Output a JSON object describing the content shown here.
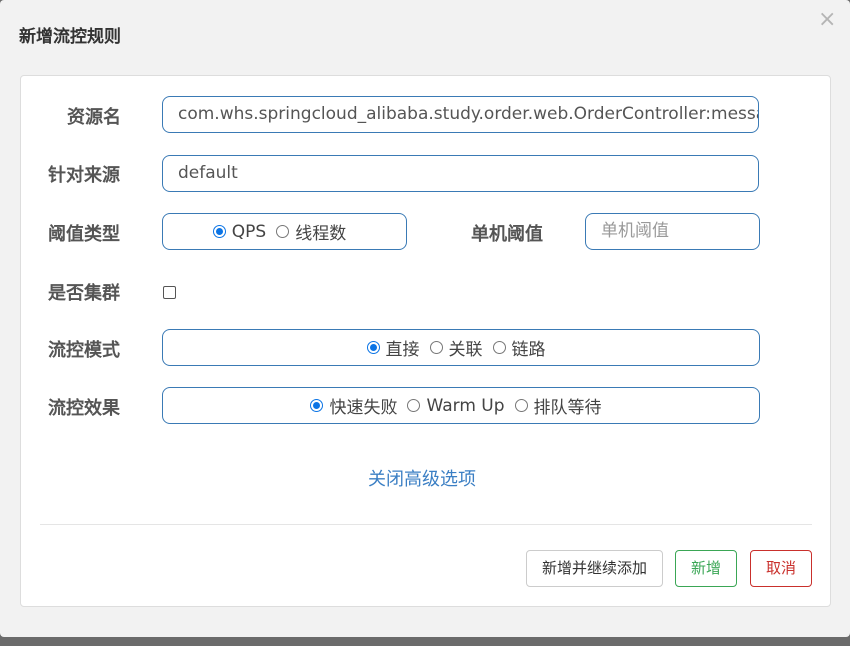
{
  "dialog": {
    "title": "新增流控规则",
    "close_glyph": "×"
  },
  "form": {
    "resource": {
      "label": "资源名",
      "value": "com.whs.springcloud_alibaba.study.order.web.OrderController:message()"
    },
    "limit_app": {
      "label": "针对来源",
      "value": "default"
    },
    "grade": {
      "label": "阈值类型",
      "options": [
        "QPS",
        "线程数"
      ],
      "selected": "QPS"
    },
    "threshold": {
      "label": "单机阈值",
      "placeholder": "单机阈值"
    },
    "cluster": {
      "label": "是否集群",
      "checked": false
    },
    "strategy": {
      "label": "流控模式",
      "options": [
        "直接",
        "关联",
        "链路"
      ],
      "selected": "直接"
    },
    "behavior": {
      "label": "流控效果",
      "options": [
        "快速失败",
        "Warm Up",
        "排队等待"
      ],
      "selected": "快速失败"
    },
    "advanced_link": "关闭高级选项"
  },
  "buttons": {
    "add_continue": "新增并继续添加",
    "add": "新增",
    "cancel": "取消"
  },
  "colors": {
    "accent": "#0b74e5",
    "border": "#3a7ab5",
    "success": "#3aa655",
    "danger": "#c9302c",
    "link": "#3b7fc4"
  }
}
